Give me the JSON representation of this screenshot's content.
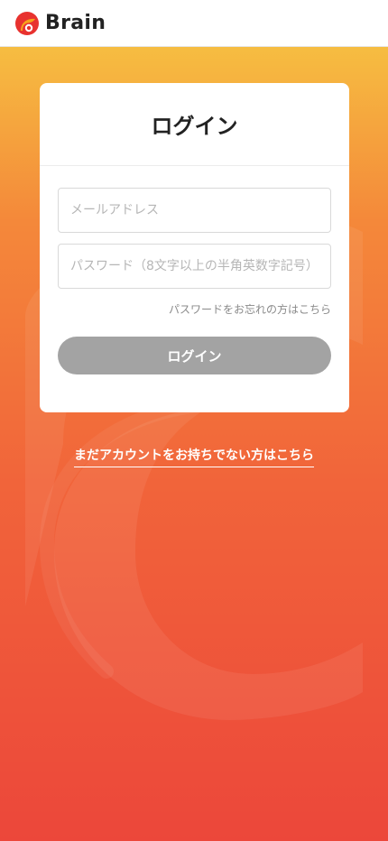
{
  "header": {
    "brand_name": "Brain",
    "logo_icon": "brain-logo-icon"
  },
  "login_card": {
    "title": "ログイン",
    "email": {
      "placeholder": "メールアドレス",
      "value": ""
    },
    "password": {
      "placeholder": "パスワード（8文字以上の半角英数字記号）",
      "value": ""
    },
    "forgot_link": "パスワードをお忘れの方はこちら",
    "submit_label": "ログイン"
  },
  "register_link": "まだアカウントをお持ちでない方はこちら",
  "colors": {
    "gradient_top": "#f6bd41",
    "gradient_bottom": "#ec473a",
    "button_disabled": "#a3a3a3",
    "logo_red": "#e8322f",
    "logo_orange": "#f7a21b"
  }
}
